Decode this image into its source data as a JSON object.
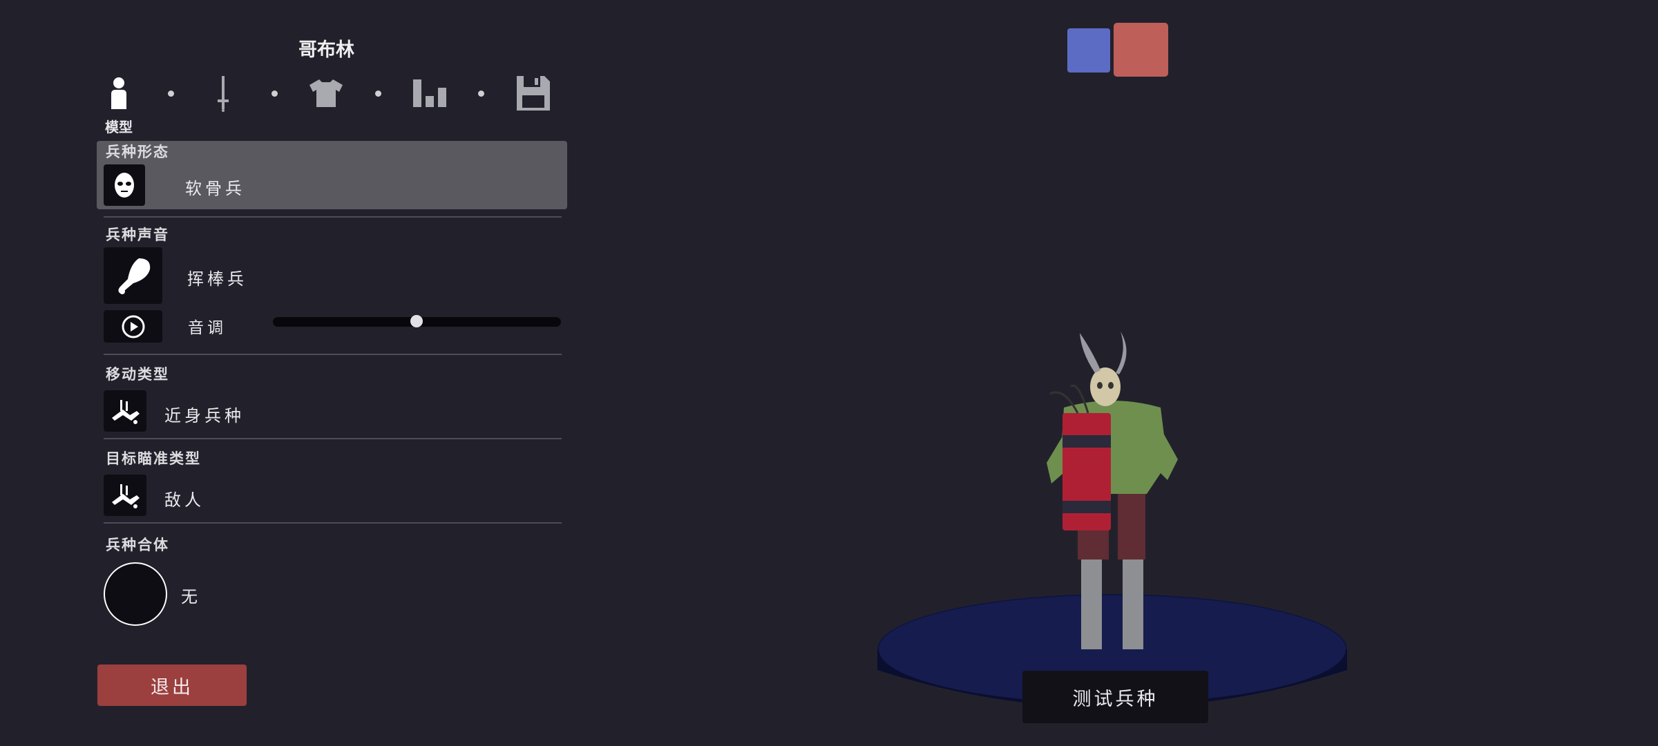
{
  "header": {
    "title": "哥布林"
  },
  "steps": {
    "active_label": "模型",
    "items": [
      "person-icon",
      "sword-icon",
      "shirt-icon",
      "bar-chart-icon",
      "floppy-disk-icon"
    ]
  },
  "sections": {
    "form": {
      "heading": "兵种形态",
      "value": "软骨兵"
    },
    "voice": {
      "heading": "兵种声音",
      "value": "挥棒兵",
      "pitch_label": "音调",
      "pitch_level": 0.5
    },
    "movement": {
      "heading": "移动类型",
      "value": "近身兵种"
    },
    "targeting": {
      "heading": "目标瞄准类型",
      "value": "敌人"
    },
    "mount": {
      "heading": "兵种合体",
      "value": "无"
    }
  },
  "buttons": {
    "exit": "退出",
    "test_unit": "测试兵种"
  },
  "team_colors": {
    "blue": "#5c6cc4",
    "red": "#bf5f5a"
  },
  "colors": {
    "background": "#22212b",
    "selected_row": "#5a5960",
    "exit": "#9b3f3f"
  }
}
